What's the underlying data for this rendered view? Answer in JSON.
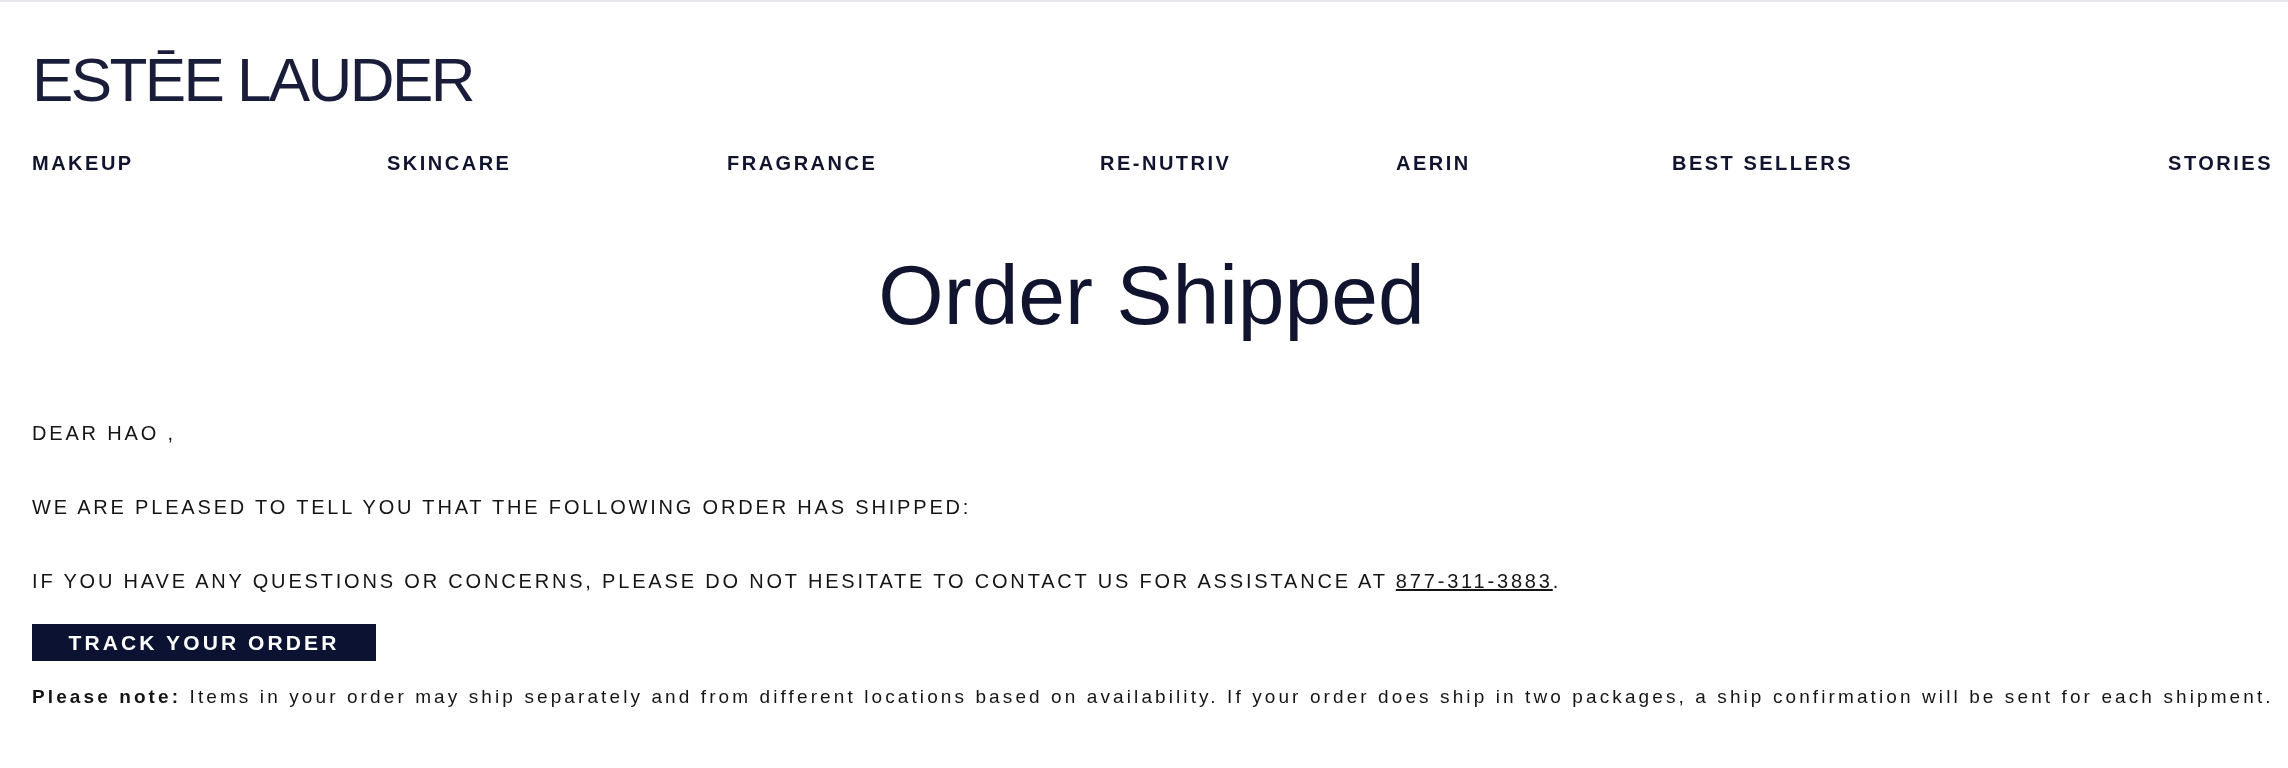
{
  "logo": {
    "text": "ESTĒE LAUDER"
  },
  "nav": {
    "items": [
      {
        "label": "MAKEUP"
      },
      {
        "label": "SKINCARE"
      },
      {
        "label": "FRAGRANCE"
      },
      {
        "label": "RE-NUTRIV"
      },
      {
        "label": "AERIN"
      },
      {
        "label": "BEST SELLERS"
      },
      {
        "label": "STORIES"
      }
    ]
  },
  "title": "Order Shipped",
  "message": {
    "greeting": "DEAR HAO ,",
    "body": "WE ARE PLEASED TO TELL YOU THAT THE FOLLOWING ORDER HAS SHIPPED:",
    "contact": {
      "text": "IF YOU HAVE ANY QUESTIONS OR CONCERNS, PLEASE DO NOT HESITATE TO CONTACT US FOR ASSISTANCE AT ",
      "phone": "877-311-3883",
      "after": "."
    }
  },
  "button": {
    "label": "TRACK YOUR ORDER"
  },
  "note": "**Please note:** Items in your order may ship separately and from different locations based on availability. If your order does ship in two packages, a ship confirmation will be sent for each shipment."
}
